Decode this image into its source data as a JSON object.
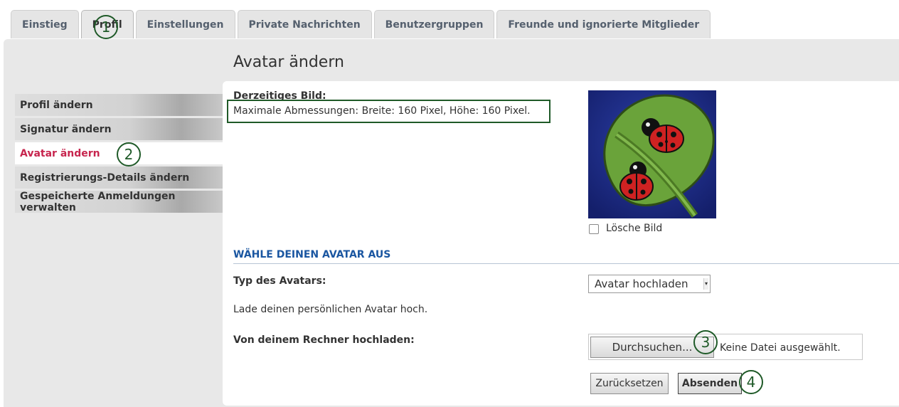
{
  "tabs": [
    "Einstieg",
    "Profil",
    "Einstellungen",
    "Private Nachrichten",
    "Benutzergruppen",
    "Freunde und ignorierte Mitglieder"
  ],
  "page_title": "Avatar ändern",
  "sidebar": {
    "items": [
      {
        "label": "Profil ändern",
        "active": false
      },
      {
        "label": "Signatur ändern",
        "active": false
      },
      {
        "label": "Avatar ändern",
        "active": true
      },
      {
        "label": "Registrierungs-Details ändern",
        "active": false
      },
      {
        "label": "Gespeicherte Anmeldungen verwalten",
        "active": false
      }
    ]
  },
  "current_image": {
    "label": "Derzeitiges Bild:",
    "max_dims": "Maximale Abmessungen: Breite: 160 Pixel, Höhe: 160 Pixel.",
    "delete_label": "Lösche Bild",
    "avatar_icon": "ladybug-leaf-icon"
  },
  "choose": {
    "heading": "WÄHLE DEINEN AVATAR AUS",
    "type_label": "Typ des Avatars:",
    "type_value": "Avatar hochladen",
    "description": "Lade deinen persönlichen Avatar hoch.",
    "upload_label": "Von deinem Rechner hochladen:",
    "browse_label": "Durchsuchen...",
    "no_file": "Keine Datei ausgewählt."
  },
  "buttons": {
    "reset": "Zurücksetzen",
    "submit": "Absenden"
  },
  "annotations": [
    "1",
    "2",
    "3",
    "4"
  ],
  "colors": {
    "active_menu": "#c7254e",
    "section_heading": "#1a56a1",
    "annotation": "#1f5a28",
    "avatar_bg": "#1f2e8f"
  }
}
